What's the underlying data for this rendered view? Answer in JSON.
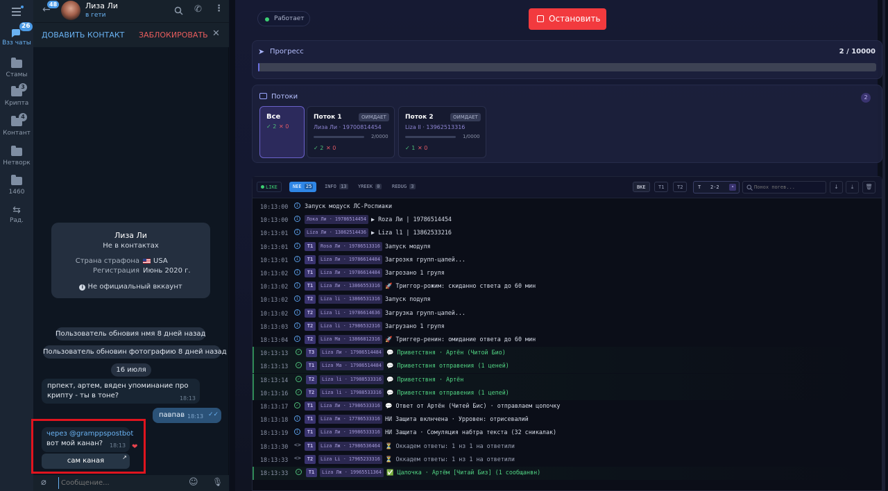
{
  "rail": {
    "all_chats_badge": "26",
    "all_chats_label": "Взз чаты",
    "folders": [
      {
        "label": "Стамы",
        "badge": ""
      },
      {
        "label": "Крипта",
        "badge": "3"
      },
      {
        "label": "Контант",
        "badge": "4"
      },
      {
        "label": "Нетворк",
        "badge": ""
      },
      {
        "label": "1460",
        "badge": ""
      }
    ],
    "last_label": "Рад.",
    "back_badge": "48"
  },
  "chat": {
    "contact_name": "Лиза Ли",
    "status": "в гети",
    "add_contact": "ДОВАВИТЬ КОНТАКТ",
    "block": "ЗАБЛОКИРОВАТЬ",
    "info": {
      "name": "Лиза Ли",
      "subtitle": "Не в контактах",
      "country_label": "Страна страфона",
      "country_value": "USA",
      "reg_label": "Регистрация",
      "reg_value": "Июнь 2020 г.",
      "warning": "Не официальный вккаунт"
    },
    "service_1": "Пользователь обновия нмя 8 дней назад",
    "service_2": "Пользователь обновин фотографию 8 дней назад",
    "date": "16 июля",
    "msg_in_1": "прпект, артем, вяден упоминание про крипту - ты в тоне?",
    "msg_in_1_time": "18:13",
    "msg_out_1": "павпав",
    "msg_out_1_time": "18:13",
    "via": "через @gramppspostbot",
    "msg_in_2": "вот мой канан?",
    "msg_in_2_time": "18:13",
    "inline_button": "сам каная",
    "composer_placeholder": "Сообщение..."
  },
  "bot": {
    "status": "Работает",
    "stop_button": "Остановить",
    "progress": {
      "title": "Прогресс",
      "value": "2 / 10000",
      "fraction": 0.0002
    },
    "threads": {
      "title": "Потоки",
      "count": "2",
      "all": {
        "label": "Все",
        "ok": "✓ 2",
        "err": "✕ 0"
      },
      "items": [
        {
          "name": "Поток 1",
          "tag": "ОИМДАЕТ",
          "account": "Лиза Ли · 19700814454",
          "count": "2/0000",
          "ok": "✓ 2",
          "err": "✕ 0"
        },
        {
          "name": "Поток 2",
          "tag": "ОИМДАЕТ",
          "account": "Liza ll · 13962513316",
          "count": "1/0000",
          "ok": "✓ 1",
          "err": "✕ 0"
        }
      ]
    },
    "log_toolbar": {
      "live": "LIKE",
      "tabs": [
        {
          "label": "NEE",
          "count": "25"
        },
        {
          "label": "INFO",
          "count": "13"
        },
        {
          "label": "YREEK",
          "count": "0"
        },
        {
          "label": "REDUG",
          "count": "3"
        }
      ],
      "filters": [
        "BKE",
        "T1",
        "T2"
      ],
      "select_label": "T",
      "select_value": "2-2",
      "search_placeholder": "Понох погев..."
    },
    "logs": [
      {
        "time": "10:13:00",
        "lvl": "i",
        "thread": "",
        "account": "",
        "msg": "Запуск модуск ЛС-Роспиаки"
      },
      {
        "time": "10:13:00",
        "lvl": "i",
        "thread": "",
        "account": "Лока Ли · 19786514454",
        "msg": "▶ Roza Ли | 19786514454"
      },
      {
        "time": "10:13:01",
        "lvl": "i",
        "thread": "",
        "account": "Liza Ли · 13862514436",
        "msg": "▶ Liza l1 | 13862533216"
      },
      {
        "time": "10:13:01",
        "lvl": "i",
        "thread": "T1",
        "account": "Rosa Ли · 19786513316",
        "msg": "Запуск модуля"
      },
      {
        "time": "10:13:01",
        "lvl": "i",
        "thread": "T1",
        "account": "Liza Ли · 19786614484",
        "msg": "Загрозкя групп-цапей..."
      },
      {
        "time": "10:13:02",
        "lvl": "i",
        "thread": "T1",
        "account": "Liza Ли · 19786614484",
        "msg": "Загрозано 1 груля"
      },
      {
        "time": "10:13:02",
        "lvl": "i",
        "thread": "T1",
        "account": "Liza Ли · 13866553316",
        "msg": "🚀 Триггор-рожим: скиданно ствета до 60 мин"
      },
      {
        "time": "10:13:02",
        "lvl": "i",
        "thread": "T2",
        "account": "Liza li · 13866531316",
        "msg": "Запуск подуля"
      },
      {
        "time": "10:13:02",
        "lvl": "i",
        "thread": "T2",
        "account": "Liza li · 19786614636",
        "msg": "Загрузка групп-цапей..."
      },
      {
        "time": "18:13:03",
        "lvl": "i",
        "thread": "T2",
        "account": "Liza li · 17986532316",
        "msg": "Загрузано 1 групя"
      },
      {
        "time": "18:13:04",
        "lvl": "i",
        "thread": "T2",
        "account": "Liza Ma · 13866812316",
        "msg": "🚀 Триггер-ренин: омидание ответа до 60 мин"
      },
      {
        "time": "10:13:13",
        "lvl": "ok",
        "thread": "T3",
        "account": "Liza Ли · 17986514484",
        "msg": "💬 Приветствня · Артён (Читой Био)",
        "green": true
      },
      {
        "time": "18:13:13",
        "lvl": "ok",
        "thread": "T1",
        "account": "Liza Ma · 17986514484",
        "msg": "💬 Приветствня отправения (1 ценей)",
        "green": true
      },
      {
        "time": "18:13:14",
        "lvl": "ok",
        "thread": "T2",
        "account": "Liza li · 17988533316",
        "msg": "💬 Приветствня · Артён",
        "green": true
      },
      {
        "time": "10:13:16",
        "lvl": "ok",
        "thread": "T2",
        "account": "Liza li · 17988533316",
        "msg": "💬 Приветствня отправения (1 цепей)",
        "green": true
      },
      {
        "time": "18:13:17",
        "lvl": "ok",
        "thread": "T1",
        "account": "Liza Ли · 17986533316",
        "msg": "💬 Ответ от Артён (Читей Бис) · отправлаем цопочку"
      },
      {
        "time": "18:13:18",
        "lvl": "i",
        "thread": "T1",
        "account": "Liza Лж · 17786533316",
        "msg": "НИ Защита вклнчена · Урровен: отрисевалий"
      },
      {
        "time": "18:13:19",
        "lvl": "i",
        "thread": "T1",
        "account": "Liza Ли · 19986533316",
        "msg": "НИ Защита · Сомуляция набтра текста (32 сникалак)"
      },
      {
        "time": "18:13:30",
        "lvl": "code",
        "thread": "T1",
        "account": "Liza Лж · 17986536464",
        "msg": "⏳ Оккадем ответы: 1 нз 1 на ответили",
        "dim": true
      },
      {
        "time": "18:13:33",
        "lvl": "code",
        "thread": "T2",
        "account": "Liza Li · 17965233316",
        "msg": "⏳ Оккадем ответы: 1 нз 1 на ответили",
        "dim": true
      },
      {
        "time": "18:13:33",
        "lvl": "ok",
        "thread": "T1",
        "account": "Liza Лж · 19965511364",
        "msg": "✅ Цалочка · Артём [Читай Биз] (1 сообщанвн)",
        "green": true
      }
    ]
  }
}
